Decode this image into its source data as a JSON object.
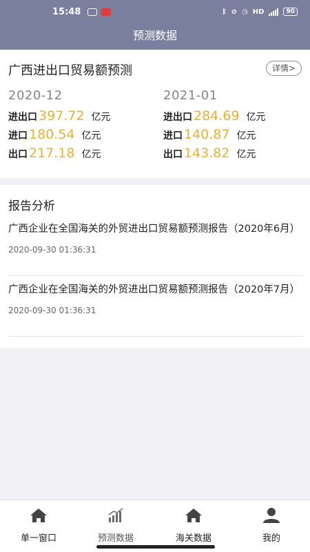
{
  "status_bar": {
    "time": "15:48",
    "battery": "90"
  },
  "header": {
    "title": "预测数据"
  },
  "forecast": {
    "title": "广西进出口贸易额预测",
    "detail_label": "详情>",
    "periods": [
      {
        "period": "2020-12",
        "rows": [
          {
            "label": "进出口",
            "value": "397.72",
            "unit": "亿元"
          },
          {
            "label": "进口",
            "value": "180.54",
            "unit": "亿元"
          },
          {
            "label": "出口",
            "value": "217.18",
            "unit": "亿元"
          }
        ]
      },
      {
        "period": "2021-01",
        "rows": [
          {
            "label": "进出口",
            "value": "284.69",
            "unit": "亿元"
          },
          {
            "label": "进口",
            "value": "140.87",
            "unit": "亿元"
          },
          {
            "label": "出口",
            "value": "143.82",
            "unit": "亿元"
          }
        ]
      }
    ],
    "value_color": "#e7b233"
  },
  "reports": {
    "title": "报告分析",
    "items": [
      {
        "title": "广西企业在全国海关的外贸进出口贸易额预测报告（2020年6月）",
        "date": "2020-09-30 01:36:31"
      },
      {
        "title": "广西企业在全国海关的外贸进出口贸易额预测报告（2020年7月）",
        "date": "2020-09-30 01:36:31"
      }
    ]
  },
  "bottom_nav": {
    "items": [
      {
        "label": "单一窗口",
        "icon": "home-icon"
      },
      {
        "label": "预测数据",
        "icon": "chart-icon",
        "active": true
      },
      {
        "label": "海关数据",
        "icon": "home-icon"
      },
      {
        "label": "我的",
        "icon": "user-icon"
      }
    ]
  },
  "colors": {
    "header": "#7a7f9e",
    "accent_value": "#e7b233"
  }
}
